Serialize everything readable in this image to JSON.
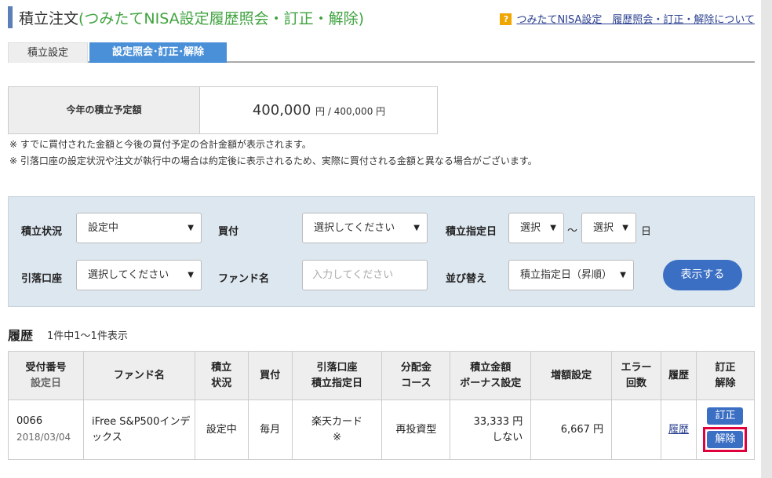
{
  "header": {
    "title": "積立注文",
    "subtitle": "(つみたてNISA設定履歴照会・訂正・解除)",
    "help_icon": "?",
    "help_link": "つみたてNISA設定　履歴照会・訂正・解除について"
  },
  "tabs": [
    {
      "label": "積立設定"
    },
    {
      "label": "設定照会･訂正･解除",
      "active": true
    }
  ],
  "annual": {
    "label": "今年の積立予定額",
    "value": "400,000",
    "unit": "円",
    "limit": " / 400,000 円"
  },
  "notes": [
    "※ すでに買付された金額と今後の買付予定の合計金額が表示されます。",
    "※ 引落口座の設定状況や注文が執行中の場合は約定後に表示されるため、実際に買付される金額と異なる場合がございます。"
  ],
  "filter": {
    "status_label": "積立状況",
    "status_value": "設定中",
    "buy_label": "買付",
    "buy_value": "選択してください",
    "date_label": "積立指定日",
    "date_from": "選択",
    "tilde": "～",
    "date_to": "選択",
    "day_unit": "日",
    "account_label": "引落口座",
    "account_value": "選択してください",
    "fund_label": "ファンド名",
    "fund_placeholder": "入力してください",
    "sort_label": "並び替え",
    "sort_value": "積立指定日（昇順）",
    "show_button": "表示する",
    "arrow": "▼"
  },
  "history": {
    "title": "履歴",
    "count": "1件中1～1件表示",
    "headers": {
      "h1a": "受付番号",
      "h1b": "設定日",
      "h2": "ファンド名",
      "h3a": "積立",
      "h3b": "状況",
      "h4": "買付",
      "h5a": "引落口座",
      "h5b": "積立指定日",
      "h6a": "分配金",
      "h6b": "コース",
      "h7a": "積立金額",
      "h7b": "ボーナス設定",
      "h8": "増額設定",
      "h9a": "エラー",
      "h9b": "回数",
      "h10": "履歴",
      "h11a": "訂正",
      "h11b": "解除"
    },
    "row": {
      "number": "0066",
      "date": "2018/03/04",
      "fund": "iFree S&P500インデックス",
      "status": "設定中",
      "buy": "毎月",
      "account": "楽天カード",
      "account_day": "※",
      "course": "再投資型",
      "amount": "33,333 円",
      "bonus": "しない",
      "increase": "6,667 円",
      "errors": "",
      "history_link": "履歴",
      "edit_button": "訂正",
      "cancel_button": "解除"
    }
  },
  "colors": {
    "accent": "#4a90d9",
    "subtitle_green": "#3fa33f",
    "button_blue": "#3b6fc4",
    "highlight_red": "#e0003c"
  }
}
